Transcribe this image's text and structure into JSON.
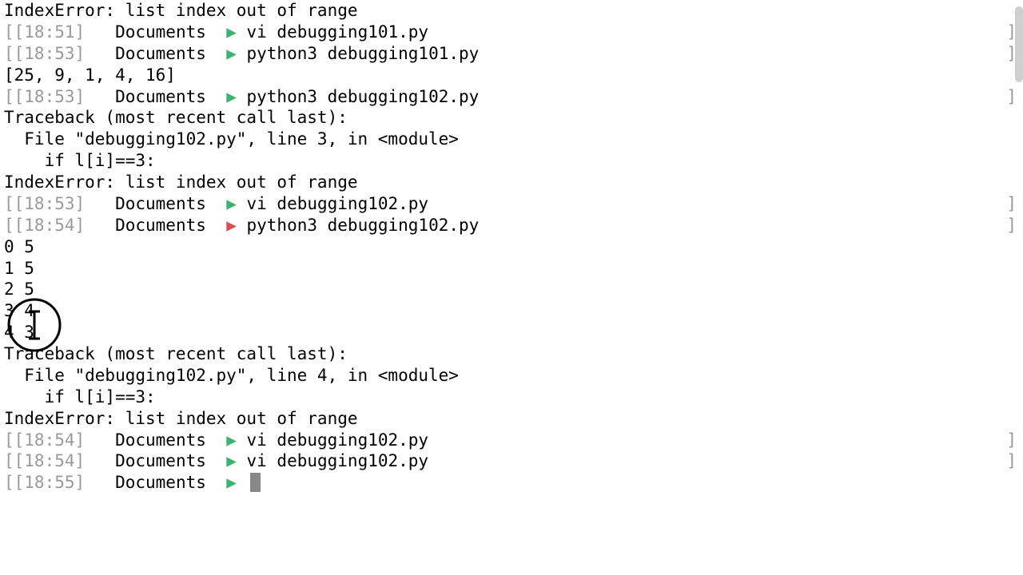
{
  "lines": [
    {
      "type": "output",
      "text": "IndexError: list index out of range"
    },
    {
      "type": "prompt",
      "time": "[[18:51]",
      "dir": "Documents",
      "arrow": "green",
      "cmd": "vi debugging101.py",
      "rb": true
    },
    {
      "type": "prompt",
      "time": "[[18:53]",
      "dir": "Documents",
      "arrow": "green",
      "cmd": "python3 debugging101.py",
      "rb": true
    },
    {
      "type": "output",
      "text": "[25, 9, 1, 4, 16]"
    },
    {
      "type": "prompt",
      "time": "[[18:53]",
      "dir": "Documents",
      "arrow": "green",
      "cmd": "python3 debugging102.py",
      "rb": true
    },
    {
      "type": "output",
      "text": "Traceback (most recent call last):"
    },
    {
      "type": "output",
      "text": "  File \"debugging102.py\", line 3, in <module>"
    },
    {
      "type": "output",
      "text": "    if l[i]==3:"
    },
    {
      "type": "output",
      "text": "IndexError: list index out of range"
    },
    {
      "type": "prompt",
      "time": "[[18:53]",
      "dir": "Documents",
      "arrow": "green",
      "cmd": "vi debugging102.py",
      "rb": true
    },
    {
      "type": "prompt",
      "time": "[[18:54]",
      "dir": "Documents",
      "arrow": "red",
      "cmd": "python3 debugging102.py",
      "rb": true
    },
    {
      "type": "output",
      "text": "0 5"
    },
    {
      "type": "output",
      "text": "1 5"
    },
    {
      "type": "output",
      "text": "2 5"
    },
    {
      "type": "output",
      "text": "3 4"
    },
    {
      "type": "output",
      "text": "4 3"
    },
    {
      "type": "output",
      "text": "Traceback (most recent call last):"
    },
    {
      "type": "output",
      "text": "  File \"debugging102.py\", line 4, in <module>"
    },
    {
      "type": "output",
      "text": "    if l[i]==3:"
    },
    {
      "type": "output",
      "text": "IndexError: list index out of range"
    },
    {
      "type": "prompt",
      "time": "[[18:54]",
      "dir": "Documents",
      "arrow": "green",
      "cmd": "vi debugging102.py",
      "rb": true
    },
    {
      "type": "prompt",
      "time": "[[18:54]",
      "dir": "Documents",
      "arrow": "green",
      "cmd": "vi debugging102.py",
      "rb": true
    },
    {
      "type": "prompt",
      "time": "[[18:55]",
      "dir": "Documents",
      "arrow": "green",
      "cmd": "",
      "cursor": true
    }
  ],
  "arrow_glyph": "▶",
  "right_bracket": "]"
}
